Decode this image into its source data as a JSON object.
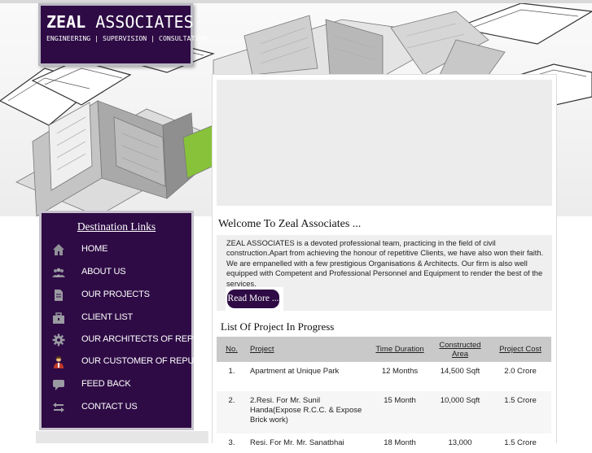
{
  "brand": {
    "name_bold": "ZEAL",
    "name_rest": "ASSOCIATES",
    "tagline": "ENGINEERING | SUPERVISION | CONSULTATION"
  },
  "sidebar": {
    "title": "Destination Links",
    "items": [
      {
        "label": "HOME",
        "icon": "home-icon"
      },
      {
        "label": "ABOUT US",
        "icon": "people-icon"
      },
      {
        "label": "OUR PROJECTS",
        "icon": "document-icon"
      },
      {
        "label": "CLIENT LIST",
        "icon": "briefcase-icon"
      },
      {
        "label": "OUR ARCHITECTS OF REPUTE",
        "icon": "gear-icon"
      },
      {
        "label": "OUR CUSTOMER OF REPUTE",
        "icon": "person-icon"
      },
      {
        "label": "FEED BACK",
        "icon": "chat-icon"
      },
      {
        "label": "CONTACT US",
        "icon": "arrows-icon"
      }
    ]
  },
  "main": {
    "welcome": "Welcome To Zeal Associates ...",
    "about": "ZEAL ASSOCIATES is a devoted professional team, practicing in the field of civil construction.Apart from achieving the honour of repetitive Clients, we have also won their faith. We are empanelled with a few prestigious Organisations & Architects. Our firm is also well equipped with Competent and Professional Personnel and Equipment to render the best of the services.",
    "read_more": "Read More ...",
    "list_title": "List Of Project In Progress",
    "table": {
      "headers": [
        "No.",
        "Project",
        "Time Duration",
        "Constructed Area",
        "Project Cost"
      ],
      "rows": [
        [
          "1.",
          "Apartment at Unique Park",
          "12 Months",
          "14,500 Sqft",
          "2.0 Crore"
        ],
        [
          "2.",
          "2.Resi. For Mr. Sunil Handa(Expose R.C.C. & Expose Brick work)",
          "15 Month",
          "10,000 Sqft",
          "1.5 Crore"
        ],
        [
          "3.",
          "Resi. For Mr. Mr. Sanatbhai",
          "18 Month",
          "13,000",
          "1.5 Crore"
        ]
      ]
    }
  },
  "colors": {
    "brand_purple": "#2e0b45",
    "header_gray": "#c9c9c9"
  }
}
